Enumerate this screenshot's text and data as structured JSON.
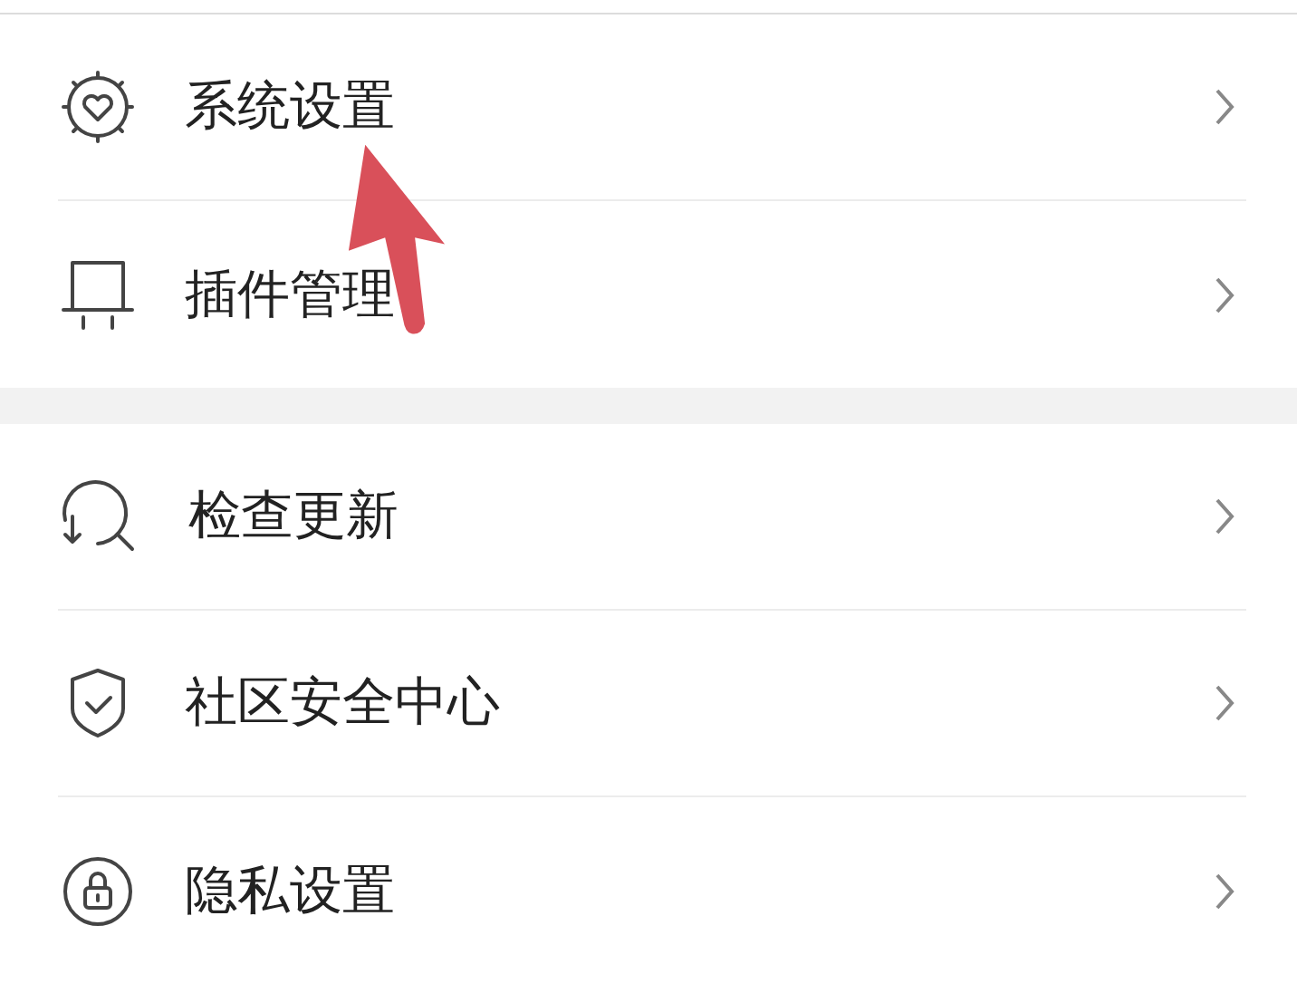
{
  "sections": [
    {
      "items": [
        {
          "kind": "system",
          "label": "系统设置"
        },
        {
          "kind": "plugin",
          "label": "插件管理"
        }
      ]
    },
    {
      "items": [
        {
          "kind": "update",
          "label": "检查更新"
        },
        {
          "kind": "security",
          "label": "社区安全中心"
        },
        {
          "kind": "privacy",
          "label": "隐私设置"
        }
      ]
    }
  ]
}
